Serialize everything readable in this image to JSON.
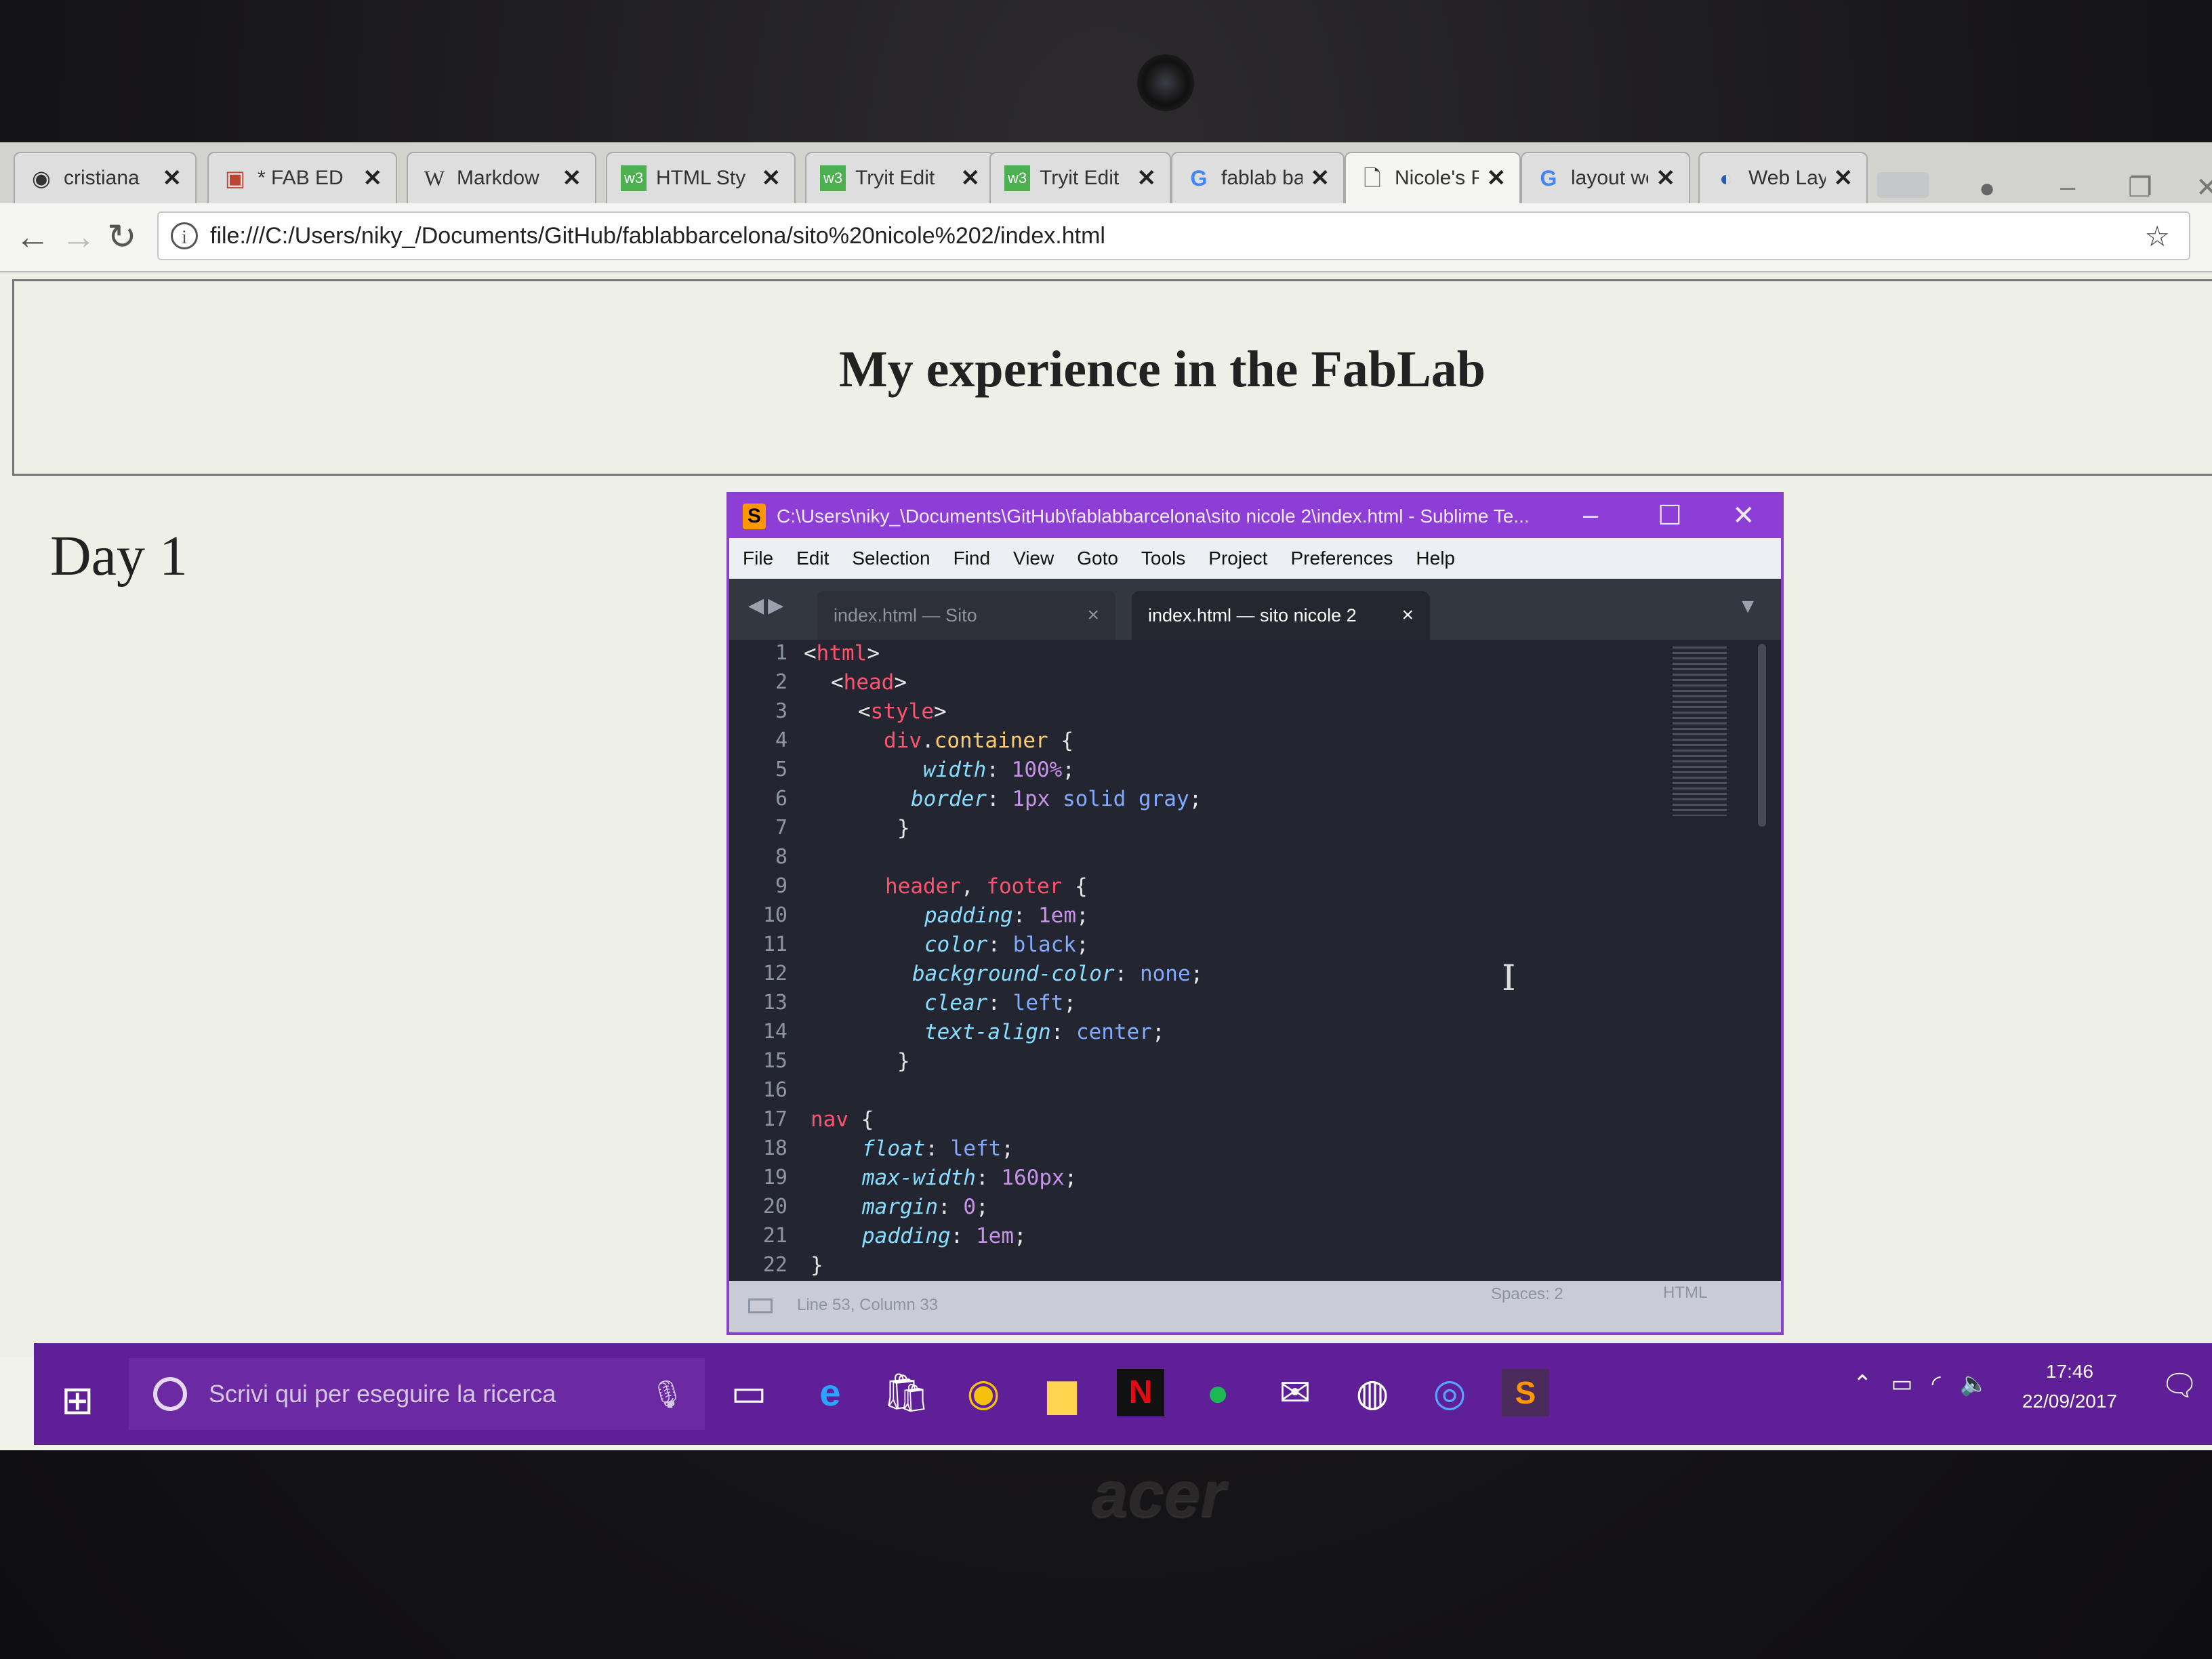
{
  "browser": {
    "tabs": [
      {
        "label": "cristiana",
        "icon": "github-icon"
      },
      {
        "label": "* FAB ED",
        "icon": "trello-icon"
      },
      {
        "label": "Markdow",
        "icon": "wikipedia-icon"
      },
      {
        "label": "HTML Sty",
        "icon": "w3schools-icon"
      },
      {
        "label": "Tryit Edit",
        "icon": "w3schools-icon"
      },
      {
        "label": "Tryit Edit",
        "icon": "w3schools-icon"
      },
      {
        "label": "fablab ba",
        "icon": "google-icon"
      },
      {
        "label": "Nicole's F",
        "icon": "document-icon"
      },
      {
        "label": "layout we",
        "icon": "google-icon"
      },
      {
        "label": "Web Lay",
        "icon": "web-icon"
      }
    ],
    "close_glyph": "✕",
    "url": "file:///C:/Users/niky_/Documents/GitHub/fablabbarcelona/sito%20nicole%202/index.html"
  },
  "page": {
    "title": "My experience in the FabLab",
    "nav_text": "Day 1"
  },
  "sublime": {
    "title": "C:\\Users\\niky_\\Documents\\GitHub\\fablabbarcelona\\sito nicole 2\\index.html - Sublime Te...",
    "menu": [
      "File",
      "Edit",
      "Selection",
      "Find",
      "View",
      "Goto",
      "Tools",
      "Project",
      "Preferences",
      "Help"
    ],
    "tabs": [
      {
        "label": "index.html — Sito"
      },
      {
        "label": "index.html — sito nicole 2"
      }
    ],
    "line_numbers": [
      "1",
      "2",
      "3",
      "4",
      "5",
      "6",
      "7",
      "8",
      "9",
      "10",
      "11",
      "12",
      "13",
      "14",
      "15",
      "16",
      "17",
      "18",
      "19",
      "20",
      "21",
      "22"
    ],
    "status": {
      "position": "Line 53, Column 33",
      "spaces": "Spaces: 2",
      "syntax": "HTML"
    }
  },
  "taskbar": {
    "search_placeholder": "Scrivi qui per eseguire la ricerca",
    "time": "17:46",
    "date": "22/09/2017",
    "apps": [
      "task-view-icon",
      "edge-icon",
      "store-icon",
      "chrome-icon",
      "file-explorer-icon",
      "netflix-icon",
      "spotify-icon",
      "mail-icon",
      "github-desktop-icon",
      "app-icon",
      "sublime-icon"
    ]
  },
  "laptop": {
    "brand": "acer"
  },
  "colors": {
    "sublime_title": "#8d3ed6",
    "taskbar": "#5f1f96",
    "editor_bg": "#232630"
  }
}
